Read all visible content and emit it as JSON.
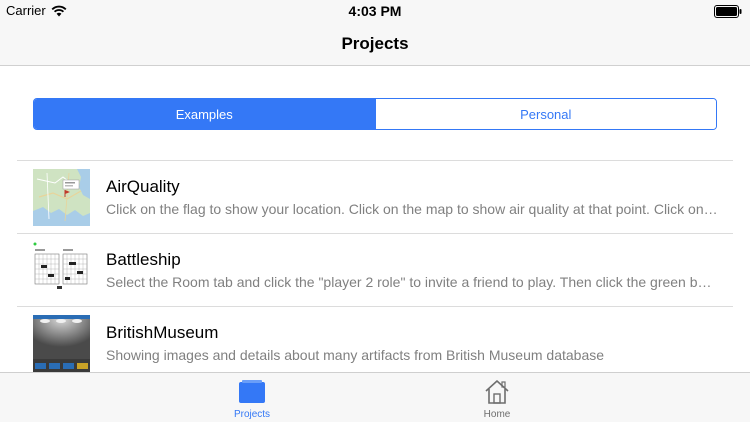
{
  "status_bar": {
    "carrier": "Carrier",
    "time": "4:03 PM",
    "icons": [
      "wifi-icon",
      "battery-icon"
    ]
  },
  "nav": {
    "title": "Projects"
  },
  "segments": [
    {
      "label": "Examples",
      "selected": true
    },
    {
      "label": "Personal",
      "selected": false
    }
  ],
  "projects": [
    {
      "title": "AirQuality",
      "description": "Click on the flag to show your location. Click on the map to show air quality at that point. Click on the marker to see details.",
      "thumbnail": "map-thumbnail"
    },
    {
      "title": "Battleship",
      "description": "Select the Room tab and click the \"player 2 role\" to invite a friend to play. Then click the green button to start.",
      "thumbnail": "grid-thumbnail"
    },
    {
      "title": "BritishMuseum",
      "description": "Showing images and details about many artifacts from British Museum database",
      "thumbnail": "gallery-thumbnail"
    }
  ],
  "tabs": [
    {
      "label": "Projects",
      "icon": "folder-icon",
      "selected": true
    },
    {
      "label": "Home",
      "icon": "house-icon",
      "selected": false
    }
  ],
  "colors": {
    "accent": "#3478f6",
    "inactive": "#6e6e6e",
    "bar_background": "#f7f7f7"
  }
}
